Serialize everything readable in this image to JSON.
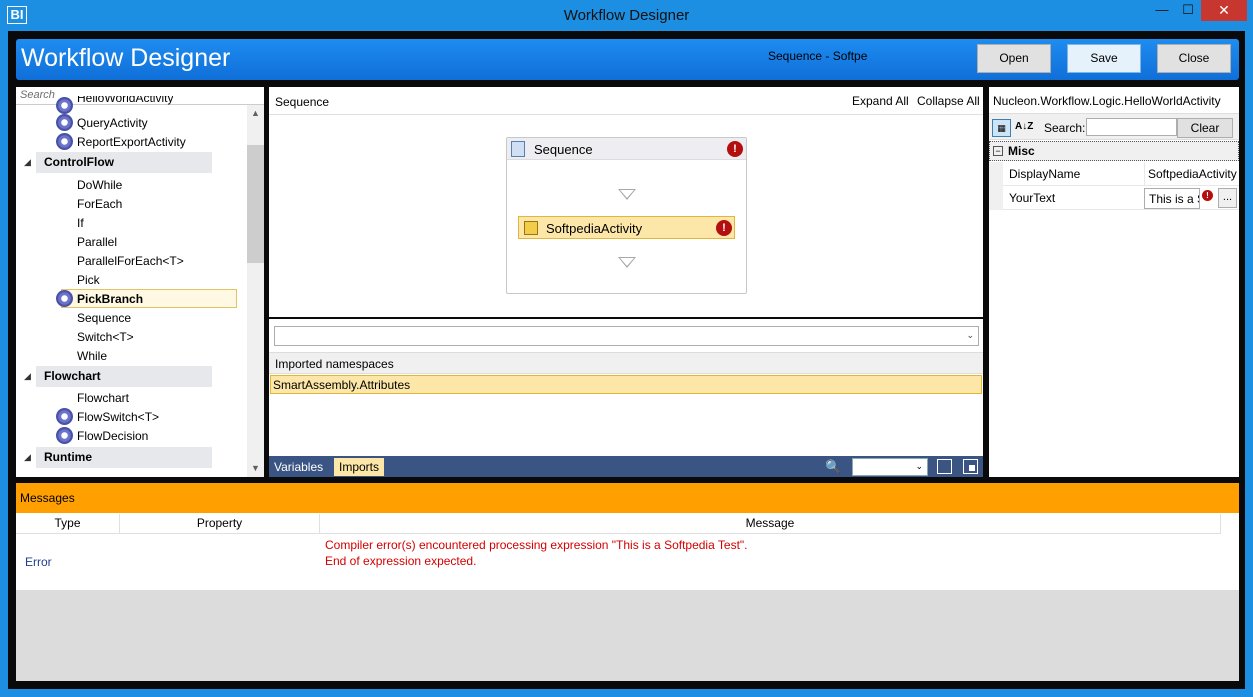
{
  "window": {
    "app_icon_text": "BI",
    "title": "Workflow Designer",
    "minimize_glyph": "—",
    "maximize_glyph": "☐",
    "close_glyph": "✕"
  },
  "header": {
    "title": "Workflow Designer",
    "document_title": "Sequence - Softpedia",
    "open_label": "Open",
    "save_label": "Save",
    "close_label": "Close"
  },
  "toolbox": {
    "search_placeholder": "Search",
    "items": {
      "hello_world": "HelloWorldActivity",
      "query": "QueryActivity",
      "report_export": "ReportExportActivity",
      "controlflow": "ControlFlow",
      "dowhile": "DoWhile",
      "foreach": "ForEach",
      "if": "If",
      "parallel": "Parallel",
      "parallel_foreach": "ParallelForEach<T>",
      "pick": "Pick",
      "pickbranch": "PickBranch",
      "sequence": "Sequence",
      "switch": "Switch<T>",
      "while": "While",
      "flowchart_cat": "Flowchart",
      "flowchart": "Flowchart",
      "flowswitch": "FlowSwitch<T>",
      "flowdecision": "FlowDecision",
      "runtime": "Runtime"
    },
    "collapse_arrow": "◢",
    "scroll_up": "▲",
    "scroll_down": "▼"
  },
  "canvas": {
    "breadcrumb": "Sequence",
    "expand_all": "Expand All",
    "collapse_all": "Collapse All",
    "sequence_label": "Sequence",
    "activity_label": "SoftpediaActivity",
    "error_glyph": "!"
  },
  "imports": {
    "header": "Imported namespaces",
    "rows": [
      "SmartAssembly.Attributes"
    ],
    "dropdown_caret": "⌄"
  },
  "bottom_tabs": {
    "variables": "Variables",
    "imports": "Imports",
    "zoom_glyph": "🔍"
  },
  "properties": {
    "title": "Nucleon.Workflow.Logic.HelloWorldActivity",
    "search_label": "Search:",
    "clear_label": "Clear",
    "az_glyph": "A↓Z",
    "category": "Misc",
    "category_toggle": "−",
    "rows": [
      {
        "name": "DisplayName",
        "value": "SoftpediaActivity"
      },
      {
        "name": "YourText",
        "value": "This is a Softpedia Test"
      }
    ],
    "ellipsis": "..."
  },
  "messages": {
    "title": "Messages",
    "columns": [
      "Type",
      "Property",
      "Message"
    ],
    "rows": [
      {
        "type": "Error",
        "property": "",
        "message_line1": "Compiler error(s) encountered processing expression \"This is a Softpedia Test\".",
        "message_line2": "End of expression expected."
      }
    ]
  },
  "colors": {
    "titlebar": "#1c8fe2",
    "header_gradient_top": "#1e8cf0",
    "messages_bar": "#ffa000",
    "selection": "#fde7a8",
    "error": "#d40000",
    "tab_bar": "#3a5583"
  }
}
